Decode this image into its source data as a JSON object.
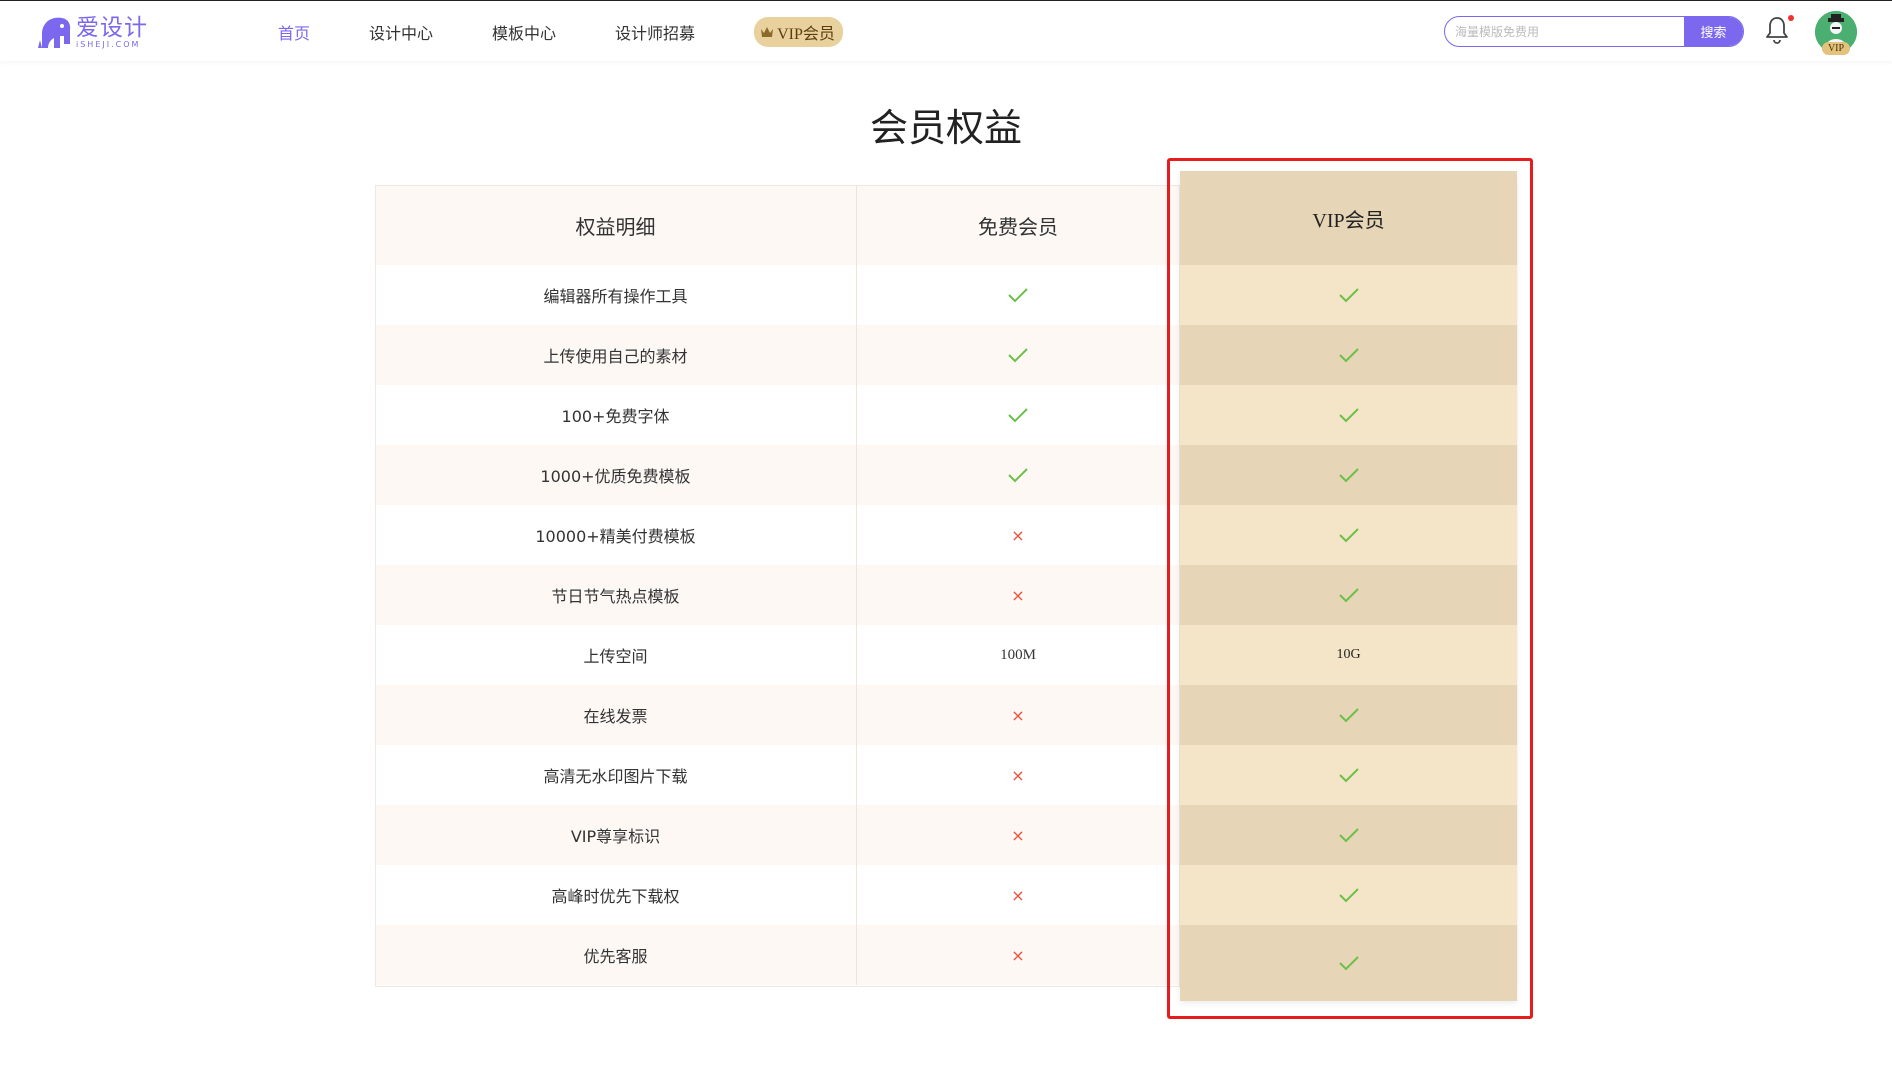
{
  "header": {
    "logo_cn": "爱设计",
    "logo_en": "iSHEJI.COM",
    "nav": [
      {
        "label": "首页",
        "active": true
      },
      {
        "label": "设计中心",
        "active": false
      },
      {
        "label": "模板中心",
        "active": false
      },
      {
        "label": "设计师招募",
        "active": false
      }
    ],
    "vip_nav_label": "VIP会员",
    "search": {
      "placeholder": "海量模版免费用",
      "value": "",
      "button_label": "搜索"
    },
    "notification_icon": "bell-icon",
    "notification_dot_color": "#f23030",
    "avatar_badge": "VIP"
  },
  "page_title": "会员权益",
  "table": {
    "headers": {
      "benefit": "权益明细",
      "free": "免费会员",
      "vip": "VIP会员"
    },
    "rows": [
      {
        "benefit": "编辑器所有操作工具",
        "free": "check",
        "vip": "check"
      },
      {
        "benefit": "上传使用自己的素材",
        "free": "check",
        "vip": "check"
      },
      {
        "benefit": "100+免费字体",
        "free": "check",
        "vip": "check"
      },
      {
        "benefit": "1000+优质免费模板",
        "free": "check",
        "vip": "check"
      },
      {
        "benefit": "10000+精美付费模板",
        "free": "cross",
        "vip": "check"
      },
      {
        "benefit": "节日节气热点模板",
        "free": "cross",
        "vip": "check"
      },
      {
        "benefit": "上传空间",
        "free": "100M",
        "vip": "10G"
      },
      {
        "benefit": "在线发票",
        "free": "cross",
        "vip": "check"
      },
      {
        "benefit": "高清无水印图片下载",
        "free": "cross",
        "vip": "check"
      },
      {
        "benefit": "VIP尊享标识",
        "free": "cross",
        "vip": "check"
      },
      {
        "benefit": "高峰时优先下载权",
        "free": "cross",
        "vip": "check"
      },
      {
        "benefit": "优先客服",
        "free": "cross",
        "vip": "check"
      }
    ]
  },
  "colors": {
    "brand": "#7b68ee",
    "vip_gold": "#e9d19d",
    "check_green": "#6cc04a",
    "cross_red": "#e8503a",
    "highlight_red": "#e81c1c",
    "row_odd": "#fdf8f4",
    "vip_light": "#f4e5c8",
    "vip_dark": "#e6d5b6"
  },
  "icons": {
    "check": "check-icon",
    "cross": "cross-icon",
    "crown": "crown-icon"
  }
}
